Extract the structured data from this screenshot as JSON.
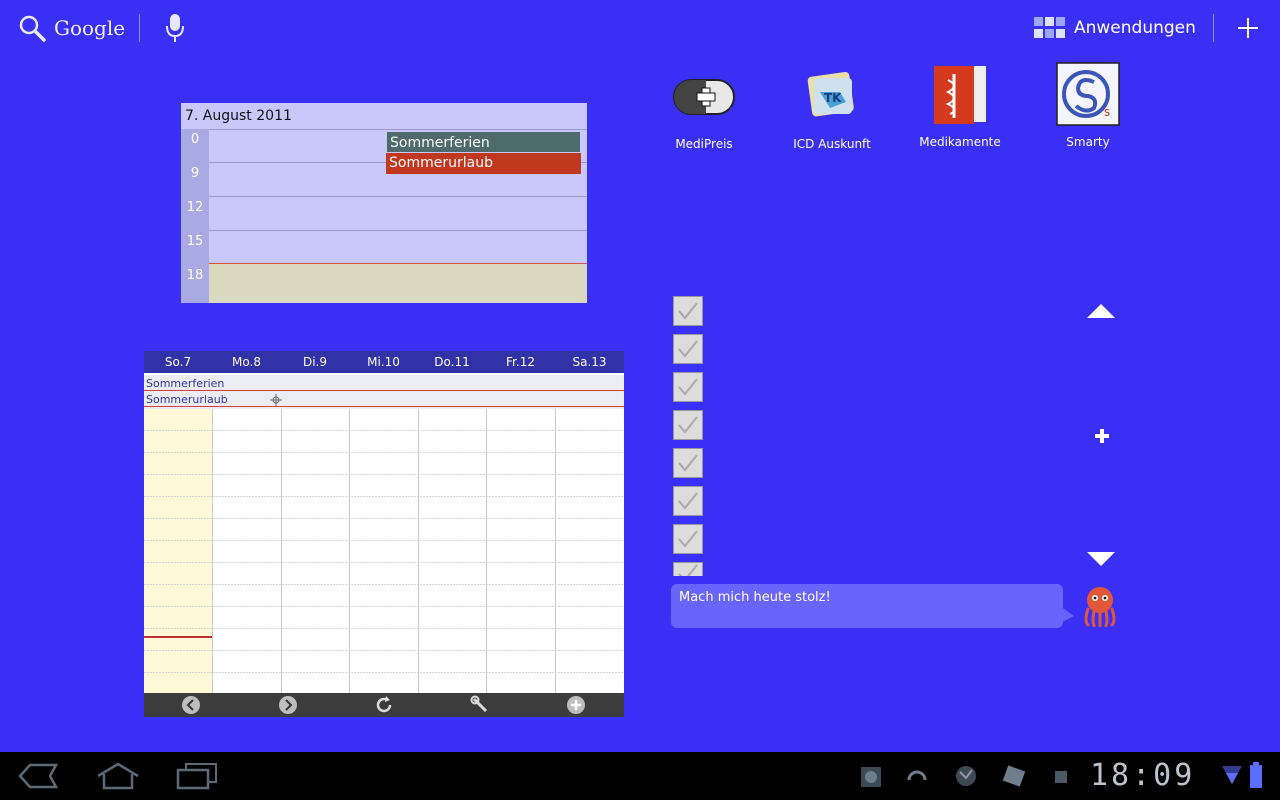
{
  "top_bar": {
    "search_label": "Google",
    "apps_label": "Anwendungen"
  },
  "day_widget": {
    "date": "7. August 2011",
    "hours": [
      "0",
      "9",
      "12",
      "15",
      "18"
    ],
    "events": [
      "Sommerferien",
      "Sommerurlaub"
    ],
    "colors": {
      "event1": "#4f6a6a",
      "event2": "#c0381f"
    }
  },
  "week_widget": {
    "days": [
      "So.7",
      "Mo.8",
      "Di.9",
      "Mi.10",
      "Do.11",
      "Fr.12",
      "Sa.13"
    ],
    "allday_events": [
      "Sommerferien",
      "Sommerurlaub"
    ],
    "toolbar_icons": [
      "prev-icon",
      "next-icon",
      "refresh-icon",
      "wrench-icon",
      "add-icon"
    ]
  },
  "apps": [
    {
      "label": "MediPreis",
      "icon": "medipreis-icon"
    },
    {
      "label": "ICD Auskunft",
      "icon": "icd-icon"
    },
    {
      "label": "Medikamente",
      "icon": "medikamente-icon"
    },
    {
      "label": "Smarty",
      "icon": "smarty-icon"
    }
  ],
  "bubble": {
    "text": "Mach mich heute stolz!"
  },
  "status": {
    "time": "18:09"
  },
  "colors": {
    "background": "#3a2ff5",
    "navbar": "#000000"
  }
}
